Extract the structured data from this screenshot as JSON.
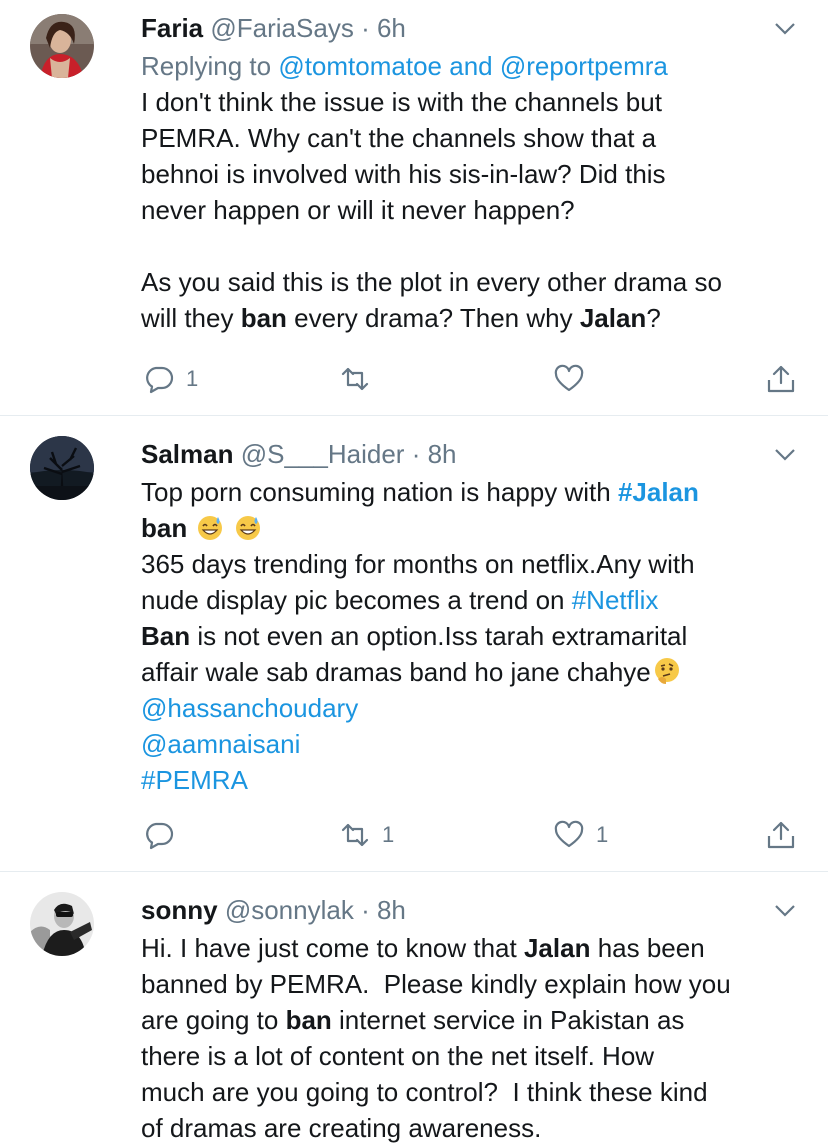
{
  "tweets": [
    {
      "name": "Faria",
      "handle": "@FariaSays",
      "dot": "·",
      "time": "6h",
      "reply_prefix": "Replying to",
      "reply_handle1": "@tomtomatoe",
      "reply_and": "and",
      "reply_handle2": "@reportpemra",
      "lines": {
        "l1": "I don't think the issue is with the channels but",
        "l2": "PEMRA. Why can't the channels show that a",
        "l3": "behnoi is involved with his sis-in-law? Did this",
        "l4": "never happen or will it never happen?",
        "l5a": "As you said this is the plot in every other drama so",
        "l6a": "will they ",
        "l6b": "ban",
        "l6c": " every drama? Then why ",
        "l6d": "Jalan",
        "l6e": "?"
      },
      "reply_count": "1",
      "retweet_count": "",
      "like_count": ""
    },
    {
      "name": "Salman",
      "handle": "@S___Haider",
      "dot": "·",
      "time": "8h",
      "lines": {
        "l1a": "Top porn consuming nation is happy with ",
        "l1b": "#Jalan",
        "l2a": "ban",
        "l3": "365 days trending for months on netflix.Any with",
        "l4a": "nude display pic becomes a trend on ",
        "l4b": "#Netflix",
        "l5a": "Ban",
        "l5b": " is not even an option.Iss tarah extramarital",
        "l6": "affair wale sab dramas band ho jane chahye",
        "l7": "@hassanchoudary",
        "l8": "@aamnaisani",
        "l9": "#PEMRA"
      },
      "reply_count": "",
      "retweet_count": "1",
      "like_count": "1"
    },
    {
      "name": "sonny",
      "handle": "@sonnylak",
      "dot": "·",
      "time": "8h",
      "lines": {
        "l1a": "Hi. I have just come to know that ",
        "l1b": "Jalan",
        "l1c": " has been",
        "l2": "banned by PEMRA.  Please kindly explain how you",
        "l3a": "are going to ",
        "l3b": "ban",
        "l3c": " internet service in Pakistan as",
        "l4": "there is a lot of content on the net itself. How",
        "l5": "much are you going to control?  I think these kind",
        "l6": "of dramas are creating awareness."
      }
    }
  ],
  "icons": {
    "reply": "reply-bubble-icon",
    "retweet": "retweet-icon",
    "like": "heart-icon",
    "share": "share-icon",
    "menu": "chevron-down-icon",
    "emoji1": "sweat-smile-emoji",
    "emoji2": "thinking-face-emoji"
  },
  "colors": {
    "link": "#1b95e0",
    "secondary": "#657786",
    "text": "#14171a",
    "divider": "#e6ecf0"
  }
}
